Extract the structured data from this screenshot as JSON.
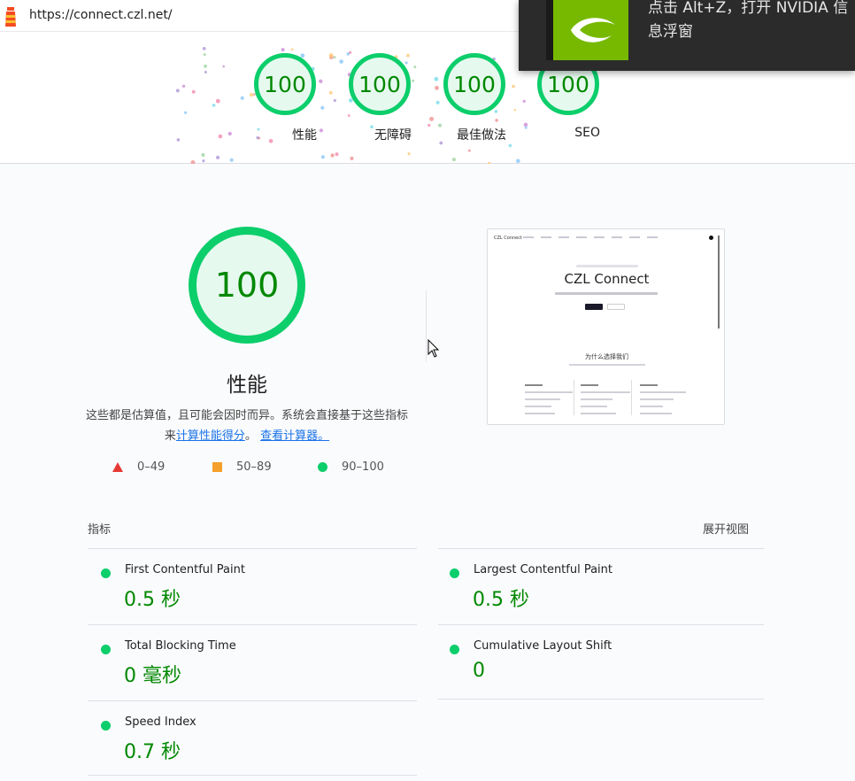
{
  "browser": {
    "url": "https://connect.czl.net/"
  },
  "nvidia_overlay": {
    "line1": "点击 Alt+Z，打开 NVIDIA 信",
    "line2": "息浮窗",
    "brand_color": "#76b900"
  },
  "gauges": [
    {
      "score": "100",
      "label": "性能"
    },
    {
      "score": "100",
      "label": "无障碍"
    },
    {
      "score": "100",
      "label": "最佳做法"
    },
    {
      "score": "100",
      "label": "SEO"
    }
  ],
  "category": {
    "score": "100",
    "title": "性能",
    "desc_prefix": "这些都是估算值，且可能会因时而异。系统会直接基于这些指标来",
    "link1": "计算性能得分",
    "sep": "。",
    "link2": "查看计算器。"
  },
  "legend": [
    {
      "range": "0–49",
      "color": "#e53935"
    },
    {
      "range": "50–89",
      "color": "#f4a02b"
    },
    {
      "range": "90–100",
      "color": "#0cce6b"
    }
  ],
  "thumbnail": {
    "nav_brand": "CZL Connect",
    "hero_title": "CZL Connect",
    "section_title": "为什么选择我们"
  },
  "metrics": {
    "header": "指标",
    "expand_label": "展开视图",
    "items": [
      {
        "name": "First Contentful Paint",
        "value": "0.5 秒"
      },
      {
        "name": "Largest Contentful Paint",
        "value": "0.5 秒"
      },
      {
        "name": "Total Blocking Time",
        "value": "0 毫秒"
      },
      {
        "name": "Cumulative Layout Shift",
        "value": "0"
      },
      {
        "name": "Speed Index",
        "value": "0.7 秒"
      }
    ]
  },
  "colors": {
    "pass": "#0cce6b",
    "pass_text": "#008800",
    "link": "#1a73e8"
  }
}
